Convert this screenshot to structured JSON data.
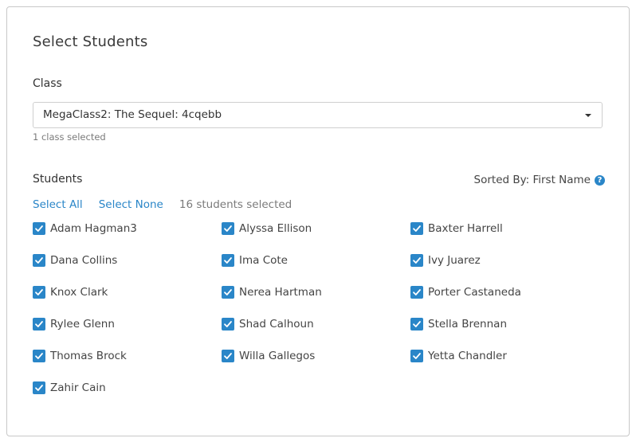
{
  "title": "Select Students",
  "class_section": {
    "label": "Class",
    "selected_value": "MegaClass2: The Sequel: 4cqebb",
    "hint": "1 class selected"
  },
  "students_section": {
    "label": "Students",
    "sorted_by": "Sorted By: First Name",
    "select_all": "Select All",
    "select_none": "Select None",
    "selected_count": "16 students selected",
    "students": [
      {
        "name": "Adam Hagman3",
        "checked": true
      },
      {
        "name": "Alyssa Ellison",
        "checked": true
      },
      {
        "name": "Baxter Harrell",
        "checked": true
      },
      {
        "name": "Dana Collins",
        "checked": true
      },
      {
        "name": "Ima Cote",
        "checked": true
      },
      {
        "name": "Ivy Juarez",
        "checked": true
      },
      {
        "name": "Knox Clark",
        "checked": true
      },
      {
        "name": "Nerea Hartman",
        "checked": true
      },
      {
        "name": "Porter Castaneda",
        "checked": true
      },
      {
        "name": "Rylee Glenn",
        "checked": true
      },
      {
        "name": "Shad Calhoun",
        "checked": true
      },
      {
        "name": "Stella Brennan",
        "checked": true
      },
      {
        "name": "Thomas Brock",
        "checked": true
      },
      {
        "name": "Willa Gallegos",
        "checked": true
      },
      {
        "name": "Yetta Chandler",
        "checked": true
      },
      {
        "name": "Zahir Cain",
        "checked": true
      }
    ]
  },
  "colors": {
    "accent": "#2a86c8",
    "muted_text": "#7a7a7a"
  },
  "icons": {
    "dropdown": "caret-down-icon",
    "help": "question-circle-icon",
    "checkbox": "checkmark-icon"
  }
}
